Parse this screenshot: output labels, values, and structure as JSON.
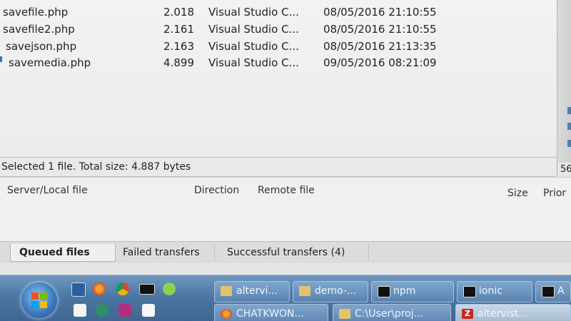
{
  "file_list": {
    "rows": [
      {
        "name": "savefile.php",
        "size": "2.018",
        "type": "Visual Studio C...",
        "modified": "08/05/2016 21:10:55"
      },
      {
        "name": "savefile2.php",
        "size": "2.161",
        "type": "Visual Studio C...",
        "modified": "08/05/2016 21:10:55"
      },
      {
        "name": "savejson.php",
        "size": "2.163",
        "type": "Visual Studio C...",
        "modified": "08/05/2016 21:13:35"
      },
      {
        "name": "savemedia.php",
        "size": "4.899",
        "type": "Visual Studio C...",
        "modified": "09/05/2016 08:21:09"
      }
    ]
  },
  "status_bar": {
    "text": "Selected 1 file. Total size: 4.887 bytes",
    "right_count": "56"
  },
  "queue": {
    "headers": {
      "server_local": "Server/Local file",
      "direction": "Direction",
      "remote": "Remote file",
      "size": "Size",
      "priority": "Prior"
    }
  },
  "tabs": {
    "queued": "Queued files",
    "failed": "Failed transfers",
    "successful": "Successful transfers (4)"
  },
  "taskbar": {
    "quick_launch": [
      "desktop-icon",
      "firefox-icon",
      "chrome-icon",
      "cmd-icon",
      "android-icon",
      "notes-icon",
      "chat-icon",
      "people-icon",
      "file-icon"
    ],
    "buttons_top": [
      {
        "label": "altervi...",
        "icon": "folder-icon"
      },
      {
        "label": "demo-...",
        "icon": "folder-icon"
      },
      {
        "label": "npm",
        "icon": "cmd-icon"
      },
      {
        "label": "ionic",
        "icon": "cmd-icon"
      },
      {
        "label": "A",
        "icon": "cmd-icon"
      }
    ],
    "buttons_bottom": [
      {
        "label": "CHATKWON...",
        "icon": "firefox-icon"
      },
      {
        "label": "C:\\User\\proj...",
        "icon": "folder-icon"
      },
      {
        "label": "altervist...",
        "icon": "filezilla-icon"
      }
    ]
  }
}
